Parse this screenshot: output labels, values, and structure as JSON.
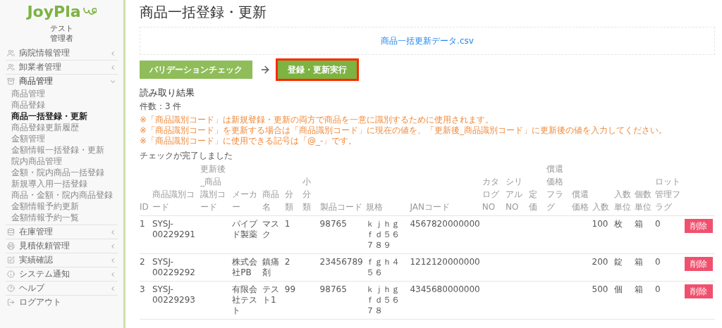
{
  "sidebar": {
    "logo": "JoyPla",
    "user": {
      "name": "テスト",
      "role": "管理者"
    },
    "sections": [
      {
        "label": "病院情報管理",
        "expanded": false
      },
      {
        "label": "卸業者管理",
        "expanded": false
      },
      {
        "label": "商品管理",
        "expanded": true,
        "children": [
          {
            "label": "商品管理",
            "selected": false
          },
          {
            "label": "商品登録",
            "selected": false
          },
          {
            "label": "商品一括登録・更新",
            "selected": true
          },
          {
            "label": "商品登録更新履歴",
            "selected": false
          },
          {
            "label": "金額管理",
            "selected": false
          },
          {
            "label": "金額情報一括登録・更新",
            "selected": false
          },
          {
            "label": "院内商品管理",
            "selected": false
          },
          {
            "label": "金額・院内商品一括登録",
            "selected": false
          },
          {
            "label": "新規導入用一括登録",
            "selected": false
          },
          {
            "label": "商品・金額・院内商品登録",
            "selected": false
          },
          {
            "label": "金額情報予約更新",
            "selected": false
          },
          {
            "label": "金額情報予約一覧",
            "selected": false
          }
        ]
      },
      {
        "label": "在庫管理",
        "expanded": false
      },
      {
        "label": "見積依頼管理",
        "expanded": false
      },
      {
        "label": "実績確認",
        "expanded": false
      },
      {
        "label": "システム通知",
        "expanded": false
      },
      {
        "label": "ヘルプ",
        "expanded": false
      }
    ],
    "logout": "ログアウト"
  },
  "page": {
    "title": "商品一括登録・更新",
    "file_name": "商品一括更新データ.csv",
    "buttons": [
      {
        "label": "バリデーションチェック",
        "highlighted": false
      },
      {
        "label": "登録・更新実行",
        "highlighted": true
      }
    ],
    "result_heading": "読み取り結果",
    "count": "件数：3 件",
    "notes": [
      "※「商品識別コード」は新規登録・更新の両方で商品を一意に識別するために使用されます。",
      "※「商品識別コード」を更新する場合は「商品識別コード」に現在の値を、「更新後_商品識別コード」に更新後の値を入力してください。",
      "※「商品識別コード」に使用できる記号は「@_-」です。"
    ],
    "status": "チェックが完了しました"
  },
  "table": {
    "columns": [
      "ID",
      "商品識別コード",
      "更新後_商品識別コード",
      "メーカー",
      "商品名",
      "分類",
      "小分類",
      "製品コード",
      "規格",
      "JANコード",
      "カタログNO",
      "シリアルNO",
      "定価",
      "償還価格フラグ",
      "償還価格",
      "入数",
      "入数単位",
      "個数単位",
      "ロット管理フラグ"
    ],
    "rows": [
      {
        "cells": [
          "1",
          "SYSJ-00229291",
          null,
          "パイプド製薬",
          "マスク",
          "1",
          null,
          "98765",
          "ｋｊｈｇｆｄ５６７８９",
          "4567820000000",
          null,
          null,
          null,
          null,
          null,
          "100",
          "枚",
          "箱",
          "0"
        ],
        "action": "削除"
      },
      {
        "cells": [
          "2",
          "SYSJ-00229292",
          null,
          "株式会社PB",
          "鎮痛剤",
          "2",
          null,
          "23456789",
          "ｆｇｈ４５６",
          "1212120000000",
          null,
          null,
          null,
          null,
          null,
          "200",
          "錠",
          "箱",
          "0"
        ],
        "action": "削除"
      },
      {
        "cells": [
          "3",
          "SYSJ-00229293",
          null,
          "有限会社テスト",
          "テスト1",
          "99",
          null,
          "98765",
          "ｋｊｈｇｆｄ５６７８",
          "4345680000000",
          null,
          null,
          null,
          null,
          null,
          "500",
          "個",
          "箱",
          "0"
        ],
        "action": "削除"
      }
    ]
  }
}
